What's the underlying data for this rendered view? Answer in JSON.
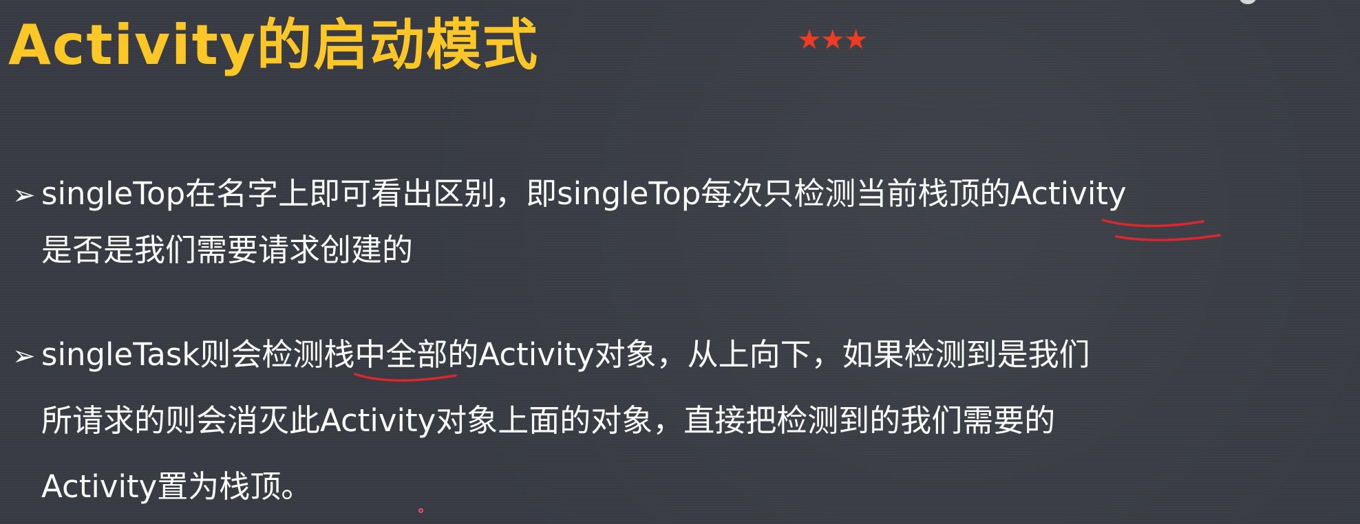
{
  "slide": {
    "title": "Activity的启动模式",
    "rating_stars": "★★★",
    "bullets": [
      {
        "marker": "➢",
        "lines": [
          "singleTop在名字上即可看出区别，即singleTop每次只检测当前栈顶的Activity",
          "是否是我们需要请求创建的"
        ]
      },
      {
        "marker": "➢",
        "lines": [
          "singleTask则会检测栈中全部的Activity对象，从上向下，如果检测到是我们",
          "所请求的则会消灭此Activity对象上面的对象，直接把检测到的我们需要的",
          "Activity置为栈顶。"
        ]
      }
    ]
  },
  "colors": {
    "background": "#383b43",
    "title": "#ffc726",
    "stars": "#ef3b1e",
    "body_text": "#ffffff",
    "annotation": "#e0262d"
  }
}
